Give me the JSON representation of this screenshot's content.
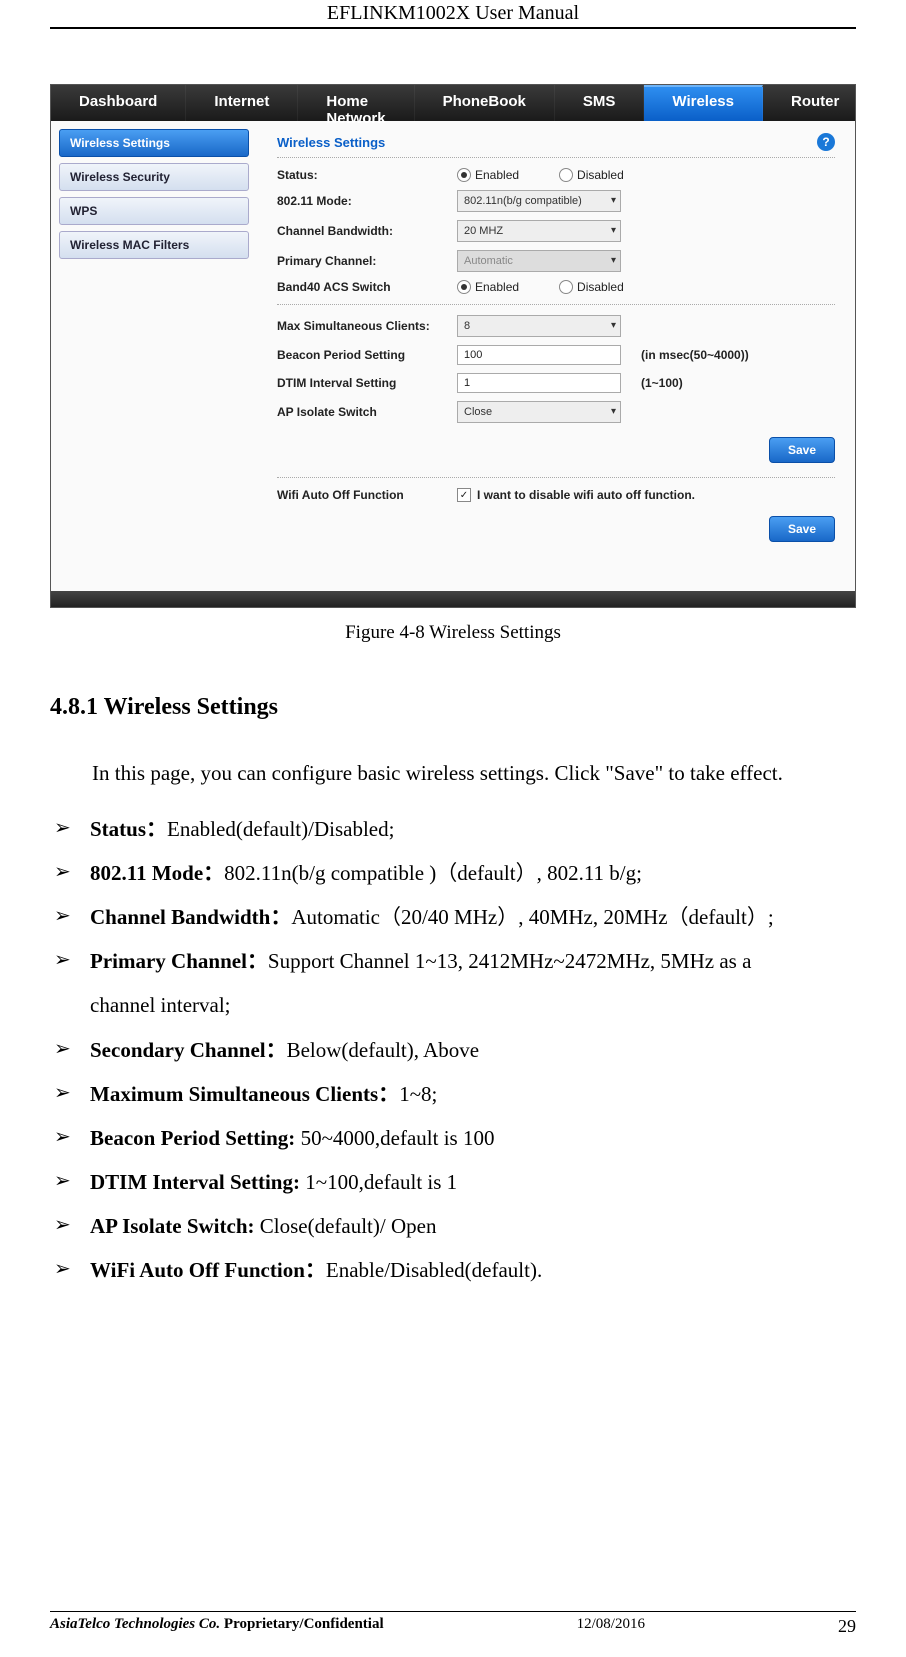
{
  "header": {
    "title": "EFLINKM1002X User Manual"
  },
  "screenshot": {
    "nav": [
      "Dashboard",
      "Internet",
      "Home Network",
      "PhoneBook",
      "SMS",
      "Wireless",
      "Router"
    ],
    "nav_active_index": 5,
    "sidebar": [
      {
        "label": "Wireless Settings",
        "active": true
      },
      {
        "label": "Wireless Security",
        "active": false
      },
      {
        "label": "WPS",
        "active": false
      },
      {
        "label": "Wireless MAC Filters",
        "active": false
      }
    ],
    "panel_title": "Wireless Settings",
    "help_glyph": "?",
    "fields": {
      "status": {
        "label": "Status:",
        "options": [
          "Enabled",
          "Disabled"
        ],
        "selected": 0
      },
      "mode": {
        "label": "802.11 Mode:",
        "value": "802.11n(b/g compatible)"
      },
      "bandwidth": {
        "label": "Channel Bandwidth:",
        "value": "20 MHZ"
      },
      "primary": {
        "label": "Primary Channel:",
        "value": "Automatic"
      },
      "band40": {
        "label": "Band40 ACS Switch",
        "options": [
          "Enabled",
          "Disabled"
        ],
        "selected": 0
      },
      "maxclients": {
        "label": "Max Simultaneous Clients:",
        "value": "8"
      },
      "beacon": {
        "label": "Beacon Period Setting",
        "value": "100",
        "hint": "(in msec(50~4000))"
      },
      "dtim": {
        "label": "DTIM Interval Setting",
        "value": "1",
        "hint": "(1~100)"
      },
      "apisolate": {
        "label": "AP Isolate Switch",
        "value": "Close"
      },
      "wifiauto": {
        "label": "Wifi Auto Off Function",
        "checkbox_checked": true,
        "text": "I want to disable wifi auto off function."
      }
    },
    "save_label": "Save"
  },
  "figure_caption": "Figure 4-8 Wireless Settings",
  "section_heading": "4.8.1 Wireless Settings",
  "intro_text": "In this page, you can configure basic wireless settings. Click \"Save\" to take effect.",
  "bullets": [
    {
      "bold": "Status：",
      "rest": "Enabled(default)/Disabled;"
    },
    {
      "bold": "802.11 Mode：",
      "rest": "802.11n(b/g compatible )（default）, 802.11 b/g;"
    },
    {
      "bold": "Channel Bandwidth：",
      "rest": "Automatic（20/40 MHz）, 40MHz, 20MHz（default）;"
    },
    {
      "bold": "Primary Channel：",
      "rest": "Support Channel 1~13, 2412MHz~2472MHz, 5MHz as a",
      "cont": "channel interval;"
    },
    {
      "bold": "Secondary Channel：",
      "rest": "Below(default), Above"
    },
    {
      "bold": "Maximum Simultaneous Clients：",
      "rest": "1~8;"
    },
    {
      "bold": "Beacon Period Setting: ",
      "rest": "50~4000,default is 100"
    },
    {
      "bold": "DTIM Interval Setting: ",
      "rest": "1~100,default is 1"
    },
    {
      "bold": "AP Isolate Switch: ",
      "rest": "Close(default)/ Open"
    },
    {
      "bold": "WiFi Auto Off Function：",
      "rest": "Enable/Disabled(default)."
    }
  ],
  "footer": {
    "company": "AsiaTelco Technologies Co.",
    "confidential": " Proprietary/Confidential",
    "date": "12/08/2016",
    "page": "29"
  }
}
